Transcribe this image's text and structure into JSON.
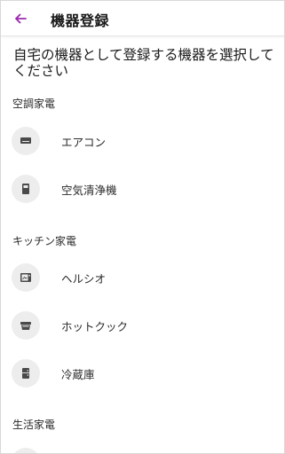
{
  "header": {
    "title": "機器登録",
    "back_icon": "arrow-left-icon",
    "accent_color": "#9c27b0"
  },
  "prompt": "自宅の機器として登録する機器を選択してください",
  "sections": [
    {
      "label": "空調家電",
      "items": [
        {
          "label": "エアコン",
          "icon": "air-conditioner-icon"
        },
        {
          "label": "空気清浄機",
          "icon": "air-purifier-icon"
        }
      ]
    },
    {
      "label": "キッチン家電",
      "items": [
        {
          "label": "ヘルシオ",
          "icon": "microwave-oven-icon"
        },
        {
          "label": "ホットクック",
          "icon": "cooking-pot-icon"
        },
        {
          "label": "冷蔵庫",
          "icon": "refrigerator-icon"
        }
      ]
    },
    {
      "label": "生活家電",
      "items": []
    }
  ]
}
